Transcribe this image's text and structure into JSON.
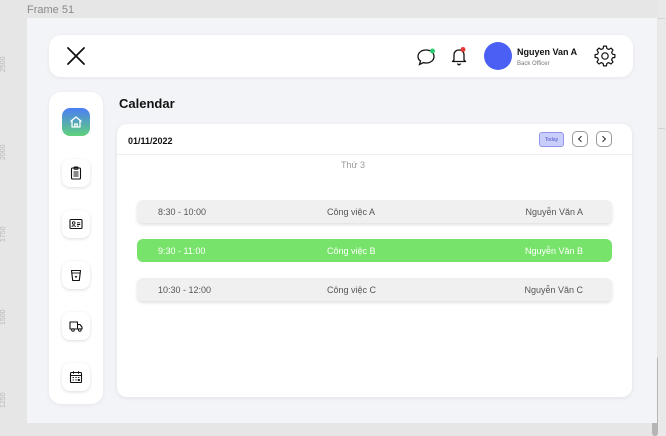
{
  "frame": {
    "label": "Frame 51"
  },
  "ruler": {
    "marks": [
      "2500",
      "2000",
      "1750",
      "1500",
      "1250"
    ]
  },
  "header": {
    "user_name": "Nguyen Van A",
    "user_role": "Back Officer",
    "icons": {
      "close": "close-icon",
      "chat": "chat-bubble-icon",
      "bell": "bell-icon",
      "settings": "gear-icon"
    },
    "colors": {
      "avatar": "#4a60f5",
      "chat_dot": "#2ecc71",
      "bell_dot": "#e53935"
    }
  },
  "sidebar": {
    "items": [
      {
        "icon": "home-icon",
        "active": true
      },
      {
        "icon": "clipboard-icon",
        "active": false
      },
      {
        "icon": "contact-card-icon",
        "active": false
      },
      {
        "icon": "cup-icon",
        "active": false
      },
      {
        "icon": "delivery-truck-icon",
        "active": false
      },
      {
        "icon": "calendar-icon",
        "active": false
      }
    ],
    "active_gradient": [
      "#4c7ef5",
      "#5fd27a"
    ]
  },
  "main": {
    "title": "Calendar"
  },
  "calendar": {
    "date": "01/11/2022",
    "today_label": "Today",
    "day_label": "Thứ 3",
    "prev_icon": "chevron-left-icon",
    "next_icon": "chevron-right-icon",
    "events": [
      {
        "time": "8:30 - 10:00",
        "task": "Công việc A",
        "person": "Nguyễn Văn A",
        "active": false
      },
      {
        "time": "9:30 - 11:00",
        "task": "Công việc B",
        "person": "Nguyễn Văn B",
        "active": true
      },
      {
        "time": "10:30 - 12:00",
        "task": "Công việc C",
        "person": "Nguyễn Văn C",
        "active": false
      }
    ],
    "colors": {
      "active_event": "#78e36a",
      "today_bg": "#c9cdfa"
    }
  }
}
